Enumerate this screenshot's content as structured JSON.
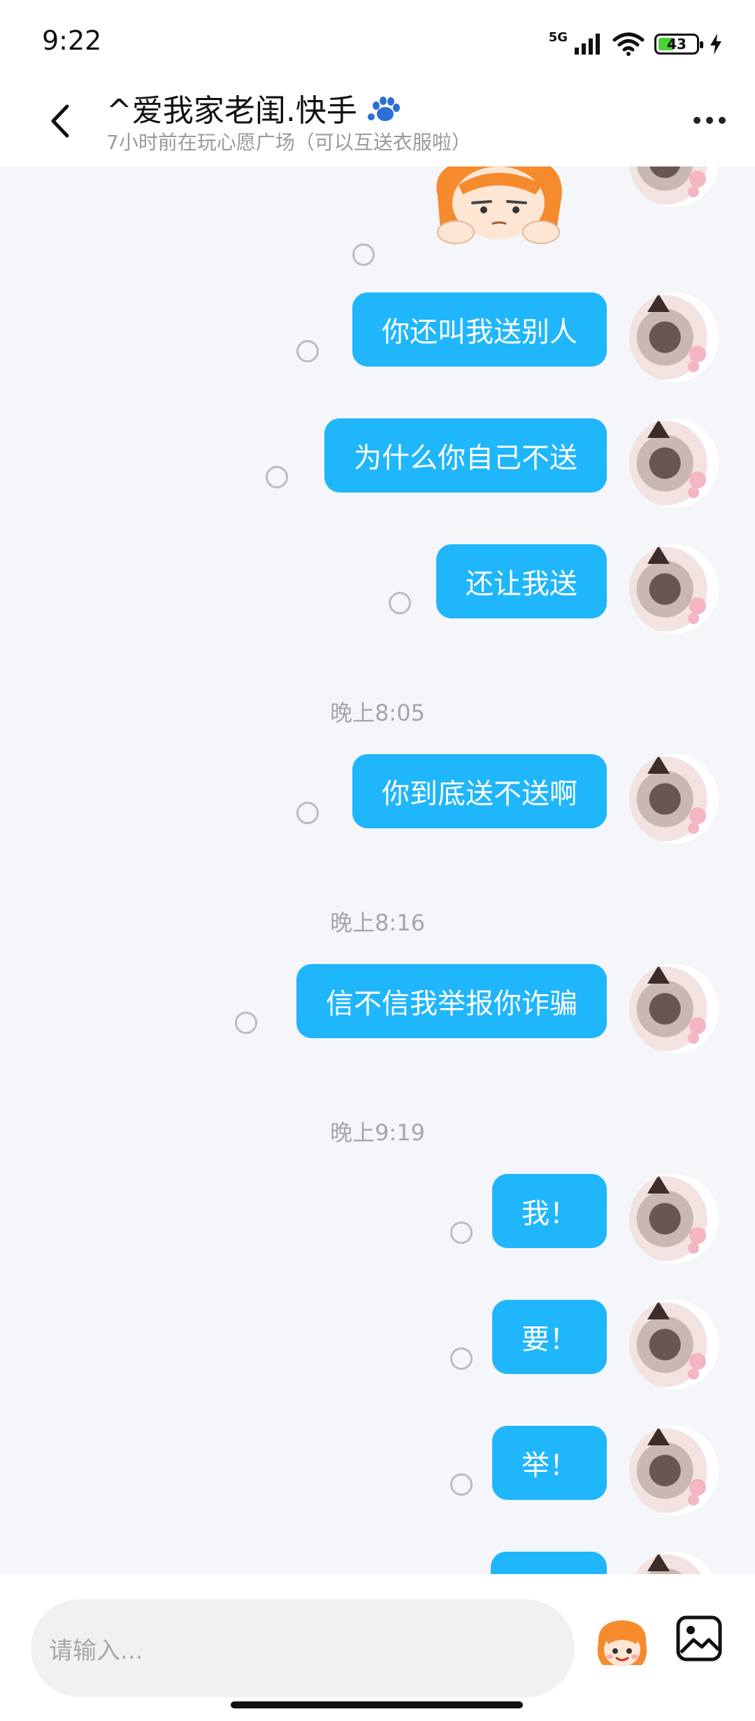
{
  "status": {
    "time": "9:22",
    "network": "5G",
    "battery": "43",
    "battery_level": 0.43
  },
  "header": {
    "title": "^爱我家老闺.快手",
    "subtitle": "7小时前在玩心愿广场（可以互送衣服啦）"
  },
  "messages": [
    {
      "type": "sticker",
      "name": "cartoon-girl-sticker"
    },
    {
      "type": "text",
      "text": "你还叫我送别人"
    },
    {
      "type": "text",
      "text": "为什么你自己不送"
    },
    {
      "type": "text",
      "text": "还让我送"
    },
    {
      "type": "time",
      "text": "晚上8:05"
    },
    {
      "type": "text",
      "text": "你到底送不送啊"
    },
    {
      "type": "time",
      "text": "晚上8:16"
    },
    {
      "type": "text",
      "text": "信不信我举报你诈骗"
    },
    {
      "type": "time",
      "text": "晚上9:19"
    },
    {
      "type": "text",
      "text": "我！"
    },
    {
      "type": "text",
      "text": "要！"
    },
    {
      "type": "text",
      "text": "举！"
    }
  ],
  "input": {
    "placeholder": "请输入..."
  },
  "colors": {
    "bubble": "#20b6fb",
    "background": "#f4f6f9"
  },
  "icons": [
    "back-arrow-icon",
    "paw-icon",
    "more-icon",
    "emoji-icon",
    "image-icon",
    "signal-icon",
    "wifi-icon",
    "charging-icon"
  ]
}
